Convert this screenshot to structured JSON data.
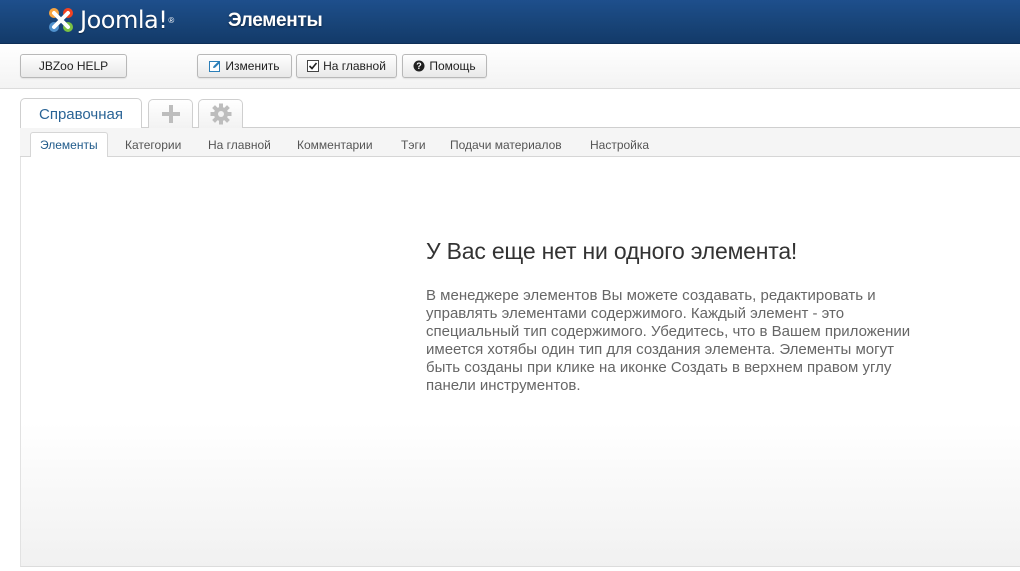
{
  "header": {
    "logo_text": "Joomla!",
    "page_title": "Элементы"
  },
  "toolbar": {
    "help_label": "JBZoo HELP",
    "edit_label": "Изменить",
    "frontpage_label": "На главной",
    "help2_label": "Помощь"
  },
  "app_tabs": {
    "active_label": "Справочная",
    "add_icon": "plus-icon",
    "settings_icon": "gear-icon"
  },
  "sub_tabs": [
    {
      "label": "Элементы"
    },
    {
      "label": "Категории"
    },
    {
      "label": "На главной"
    },
    {
      "label": "Комментарии"
    },
    {
      "label": "Тэги"
    },
    {
      "label": "Подачи материалов"
    },
    {
      "label": "Настройка"
    }
  ],
  "empty_state": {
    "title": "У Вас еще нет ни одного элемента!",
    "text_lines": [
      "В менеджере элементов Вы можете создавать, редактировать и",
      "управлять элементами содержимого. Каждый элемент - это",
      "специальный тип содержимого. Убедитесь, что в Вашем приложении",
      "имеется хотябы один тип для создания элемента. Элементы могут",
      "быть созданы при клике на иконке Создать в верхнем правом углу",
      "панели инструментов."
    ]
  },
  "colors": {
    "header_bg": "#184478",
    "active_tab_text": "#2a6496"
  }
}
